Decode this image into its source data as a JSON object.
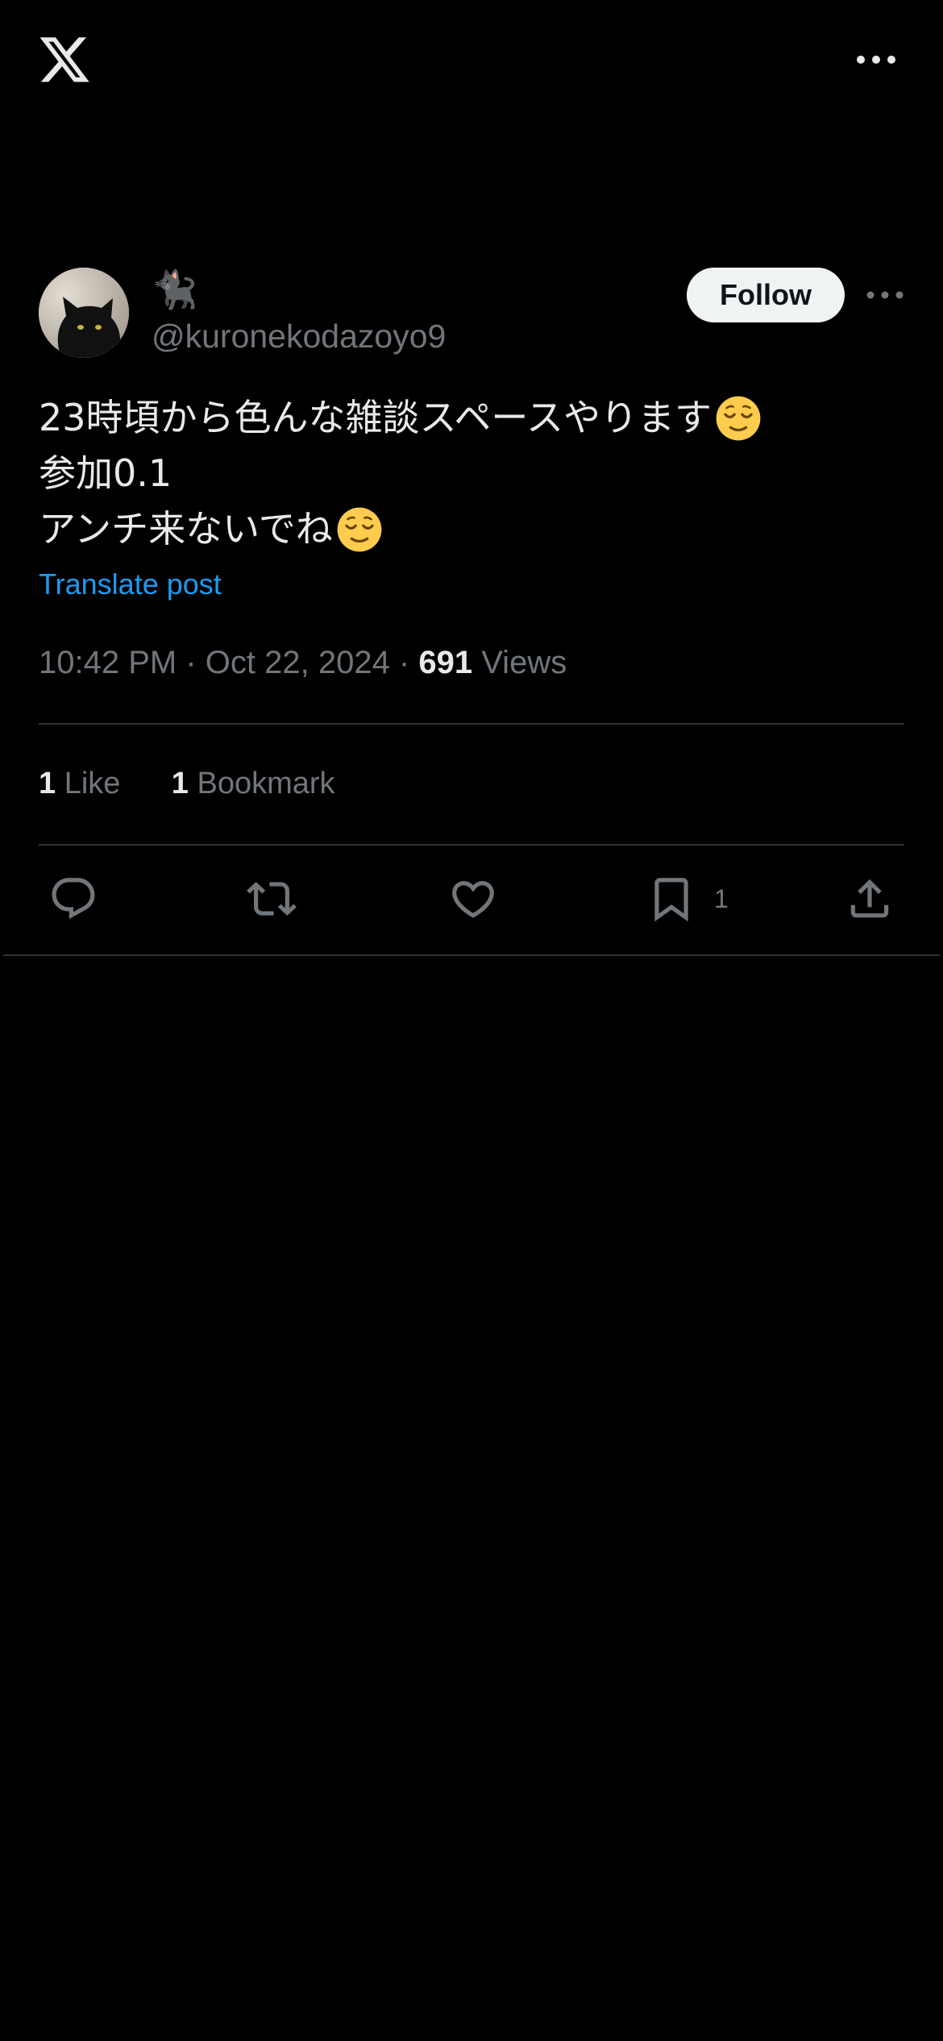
{
  "header": {
    "logo_icon": "x-logo-icon",
    "more_icon": "more-horizontal-icon"
  },
  "author": {
    "display_name": "🐈‍⬛",
    "handle": "@kuronekodazoyo9",
    "follow_label": "Follow",
    "avatar_icon": "black-cat-avatar"
  },
  "post": {
    "lines": [
      "23時頃から色んな雑談スペースやります",
      "参加0.1",
      "アンチ来ないでね"
    ],
    "emoji_icon": "relieved-face-emoji",
    "translate_label": "Translate post",
    "time": "10:42 PM",
    "separator": " · ",
    "date": "Oct 22, 2024",
    "views_count": "691",
    "views_label": " Views"
  },
  "stats": {
    "likes_count": "1",
    "likes_label": " Like",
    "bookmarks_count": "1",
    "bookmarks_label": " Bookmark"
  },
  "actions": {
    "reply_icon": "reply-icon",
    "repost_icon": "repost-icon",
    "like_icon": "heart-icon",
    "bookmark_icon": "bookmark-icon",
    "bookmark_count": "1",
    "share_icon": "share-icon"
  },
  "colors": {
    "background": "#000000",
    "text": "#e7e9ea",
    "muted": "#71767b",
    "link": "#1d9bf0",
    "divider": "#2f3336"
  }
}
